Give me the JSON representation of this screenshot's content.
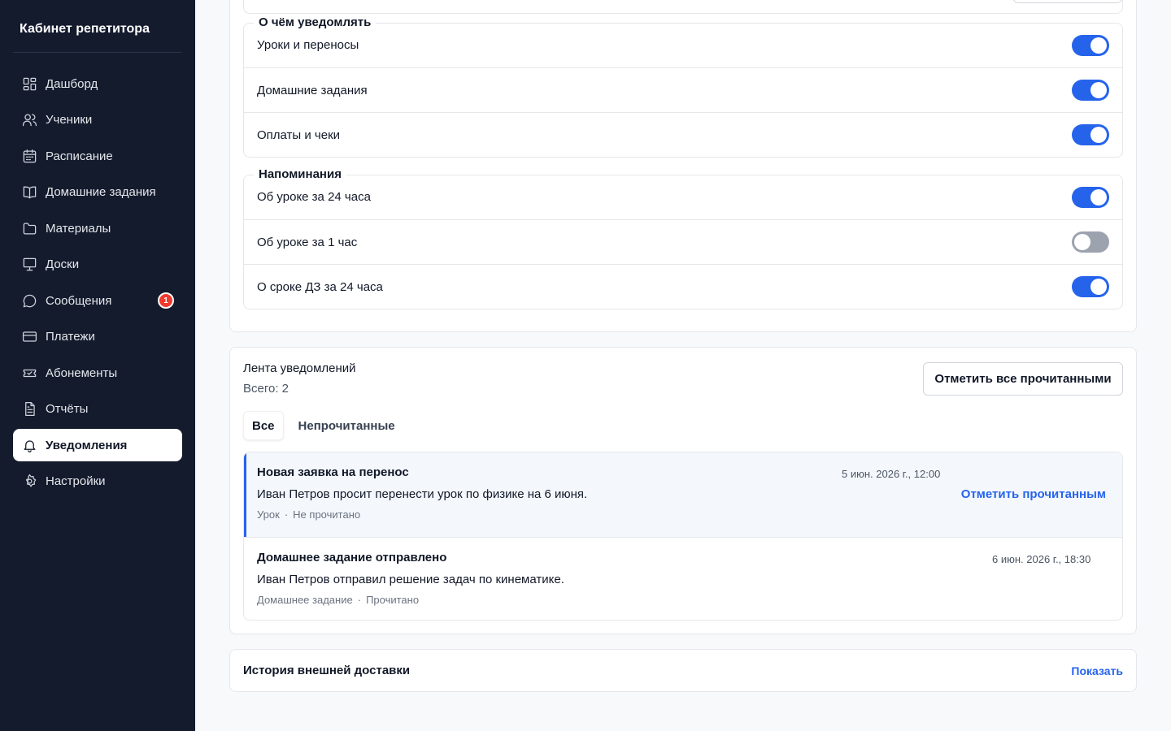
{
  "app": {
    "title": "Кабинет репетитора"
  },
  "sidebar": {
    "items": [
      {
        "label": "Дашборд",
        "icon": "dashboard-icon"
      },
      {
        "label": "Ученики",
        "icon": "users-icon"
      },
      {
        "label": "Расписание",
        "icon": "calendar-icon"
      },
      {
        "label": "Домашние задания",
        "icon": "book-icon"
      },
      {
        "label": "Материалы",
        "icon": "folder-icon"
      },
      {
        "label": "Доски",
        "icon": "board-icon"
      },
      {
        "label": "Сообщения",
        "icon": "message-icon",
        "badge": "1"
      },
      {
        "label": "Платежи",
        "icon": "credit-card-icon"
      },
      {
        "label": "Абонементы",
        "icon": "ticket-icon"
      },
      {
        "label": "Отчёты",
        "icon": "report-icon"
      },
      {
        "label": "Уведомления",
        "icon": "bell-icon",
        "active": true
      },
      {
        "label": "Настройки",
        "icon": "gear-icon"
      }
    ]
  },
  "settings": {
    "about_group": {
      "title": "О чём уведомлять",
      "rows": [
        {
          "label": "Уроки и переносы",
          "enabled": true
        },
        {
          "label": "Домашние задания",
          "enabled": true
        },
        {
          "label": "Оплаты и чеки",
          "enabled": true
        }
      ]
    },
    "reminders_group": {
      "title": "Напоминания",
      "rows": [
        {
          "label": "Об уроке за 24 часа",
          "enabled": true
        },
        {
          "label": "Об уроке за 1 час",
          "enabled": false
        },
        {
          "label": "О сроке ДЗ за 24 часа",
          "enabled": true
        }
      ]
    }
  },
  "feed": {
    "title": "Лента уведомлений",
    "total": "Всего: 2",
    "mark_all_label": "Отметить все прочитанными",
    "tabs": [
      {
        "label": "Все",
        "active": true
      },
      {
        "label": "Непрочитанные",
        "active": false
      }
    ],
    "items": [
      {
        "title": "Новая заявка на перенос",
        "body": "Иван Петров просит перенести урок по физике на 6 июня.",
        "category": "Урок",
        "status": "Не прочитано",
        "time": "5 июн. 2026 г., 12:00",
        "action": "Отметить прочитанным",
        "unread": true
      },
      {
        "title": "Домашнее задание отправлено",
        "body": "Иван Петров отправил решение задач по кинематике.",
        "category": "Домашнее задание",
        "status": "Прочитано",
        "time": "6 июн. 2026 г., 18:30",
        "unread": false
      }
    ]
  },
  "history": {
    "title": "История внешней доставки",
    "link": "Показать"
  },
  "colors": {
    "sidebar_bg": "#141b2d",
    "accent": "#2563eb",
    "badge": "#ef3a2f",
    "toggle_off": "#9ca3af"
  }
}
